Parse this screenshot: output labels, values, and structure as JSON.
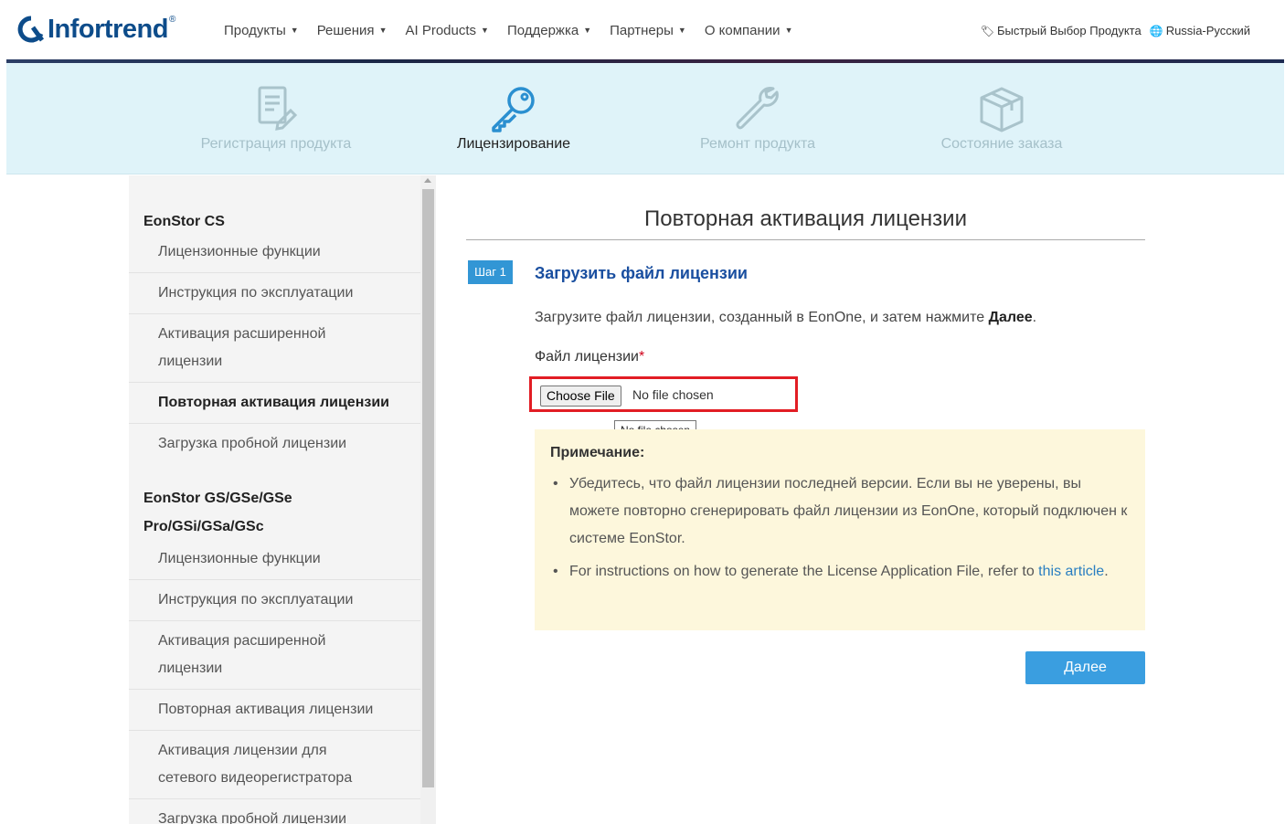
{
  "brand": {
    "logo_text": "Infortrend",
    "logo_mark": "®",
    "color": "#0d4c8a"
  },
  "nav": {
    "items": [
      {
        "label": "Продукты"
      },
      {
        "label": "Решения"
      },
      {
        "label": "AI Products"
      },
      {
        "label": "Поддержка"
      },
      {
        "label": "Партнеры"
      },
      {
        "label": "О компании"
      }
    ],
    "quick_select": "Быстрый Выбор Продукта",
    "language": "Russia-Русский"
  },
  "services": [
    {
      "label": "Регистрация продукта",
      "icon": "document-edit-icon",
      "active": false
    },
    {
      "label": "Лицензирование",
      "icon": "key-icon",
      "active": true
    },
    {
      "label": "Ремонт продукта",
      "icon": "wrench-icon",
      "active": false
    },
    {
      "label": "Состояние заказа",
      "icon": "box-icon",
      "active": false
    }
  ],
  "sidebar": {
    "group1": {
      "title": "EonStor CS",
      "items": [
        "Лицензионные функции",
        "Инструкция по эксплуатации",
        "Активация расширенной лицензии",
        "Повторная активация лицензии",
        "Загрузка пробной лицензии"
      ],
      "active_index": 3
    },
    "group2": {
      "title": "EonStor GS/GSe/GSe Pro/GSi/GSa/GSc",
      "items": [
        "Лицензионные функции",
        "Инструкция по эксплуатации",
        "Активация расширенной лицензии",
        "Повторная активация лицензии",
        "Активация лицензии для сетевого видеорегистратора",
        "Загрузка пробной лицензии"
      ]
    }
  },
  "main": {
    "title": "Повторная активация лицензии",
    "step_badge": "Шаг 1",
    "step_title": "Загрузить файл лицензии",
    "instruction_prefix": "Загрузите файл лицензии, созданный в EonOne, и затем нажмите ",
    "instruction_bold": "Далее",
    "instruction_suffix": ".",
    "field_label": "Файл лицензии",
    "required_mark": "*",
    "choose_file_label": "Choose File",
    "file_status": "No file chosen",
    "tooltip": "No file chosen",
    "note": {
      "title": "Примечание:",
      "bullet1": "Убедитесь, что файл лицензии последней версии. Если вы не уверены, вы можете повторно сгенерировать файл лицензии из EonOne, который подключен к системе EonStor.",
      "bullet2_prefix": "For instructions on how to generate the License Application File, refer to ",
      "bullet2_link": "this article",
      "bullet2_suffix": "."
    },
    "next_button": "Далее"
  },
  "colors": {
    "accent": "#3a9ee0",
    "highlight_border": "#e21d24",
    "note_bg": "#fdf7dc",
    "service_bar_bg": "#dff3f9"
  }
}
